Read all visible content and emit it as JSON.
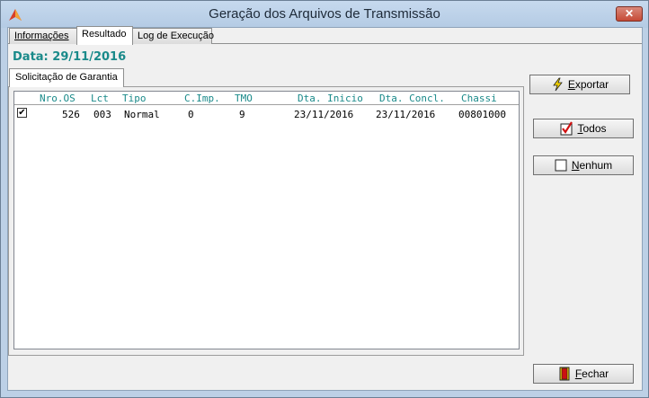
{
  "window": {
    "title": "Geração dos Arquivos de Transmissão",
    "close_symbol": "✕"
  },
  "tabs": [
    {
      "label": "Informações",
      "active": false
    },
    {
      "label": "Resultado",
      "active": true
    },
    {
      "label": "Log de Execução",
      "active": false
    }
  ],
  "date": "Data: 29/11/2016",
  "subtab": {
    "label": "Solicitação de Garantia"
  },
  "grid": {
    "columns": [
      "Nro.OS",
      "Lct",
      "Tipo",
      "C.Imp.",
      "TMO",
      "Dta. Inicio",
      "Dta. Concl.",
      "Chassi"
    ],
    "rows": [
      {
        "checked": true,
        "check_symbol": "✔",
        "nro_os": "526",
        "lct": "003",
        "tipo": "Normal",
        "c_imp": "0",
        "tmo": "9",
        "dta_inicio": "23/11/2016",
        "dta_concl": "23/11/2016",
        "chassi": "00801000"
      }
    ]
  },
  "buttons": {
    "exportar": {
      "pre": "",
      "u": "E",
      "post": "xportar",
      "icon": "lightning-icon"
    },
    "todos": {
      "pre": "",
      "u": "T",
      "post": "odos",
      "icon": "checkbox-checked-icon"
    },
    "nenhum": {
      "pre": "",
      "u": "N",
      "post": "enhum",
      "icon": "checkbox-empty-icon"
    },
    "fechar": {
      "pre": "",
      "u": "F",
      "post": "echar",
      "icon": "door-exit-icon"
    }
  },
  "colors": {
    "accent_teal": "#1a8a8a",
    "title_bg": "#bcd0e6",
    "close_red": "#c64a36"
  }
}
